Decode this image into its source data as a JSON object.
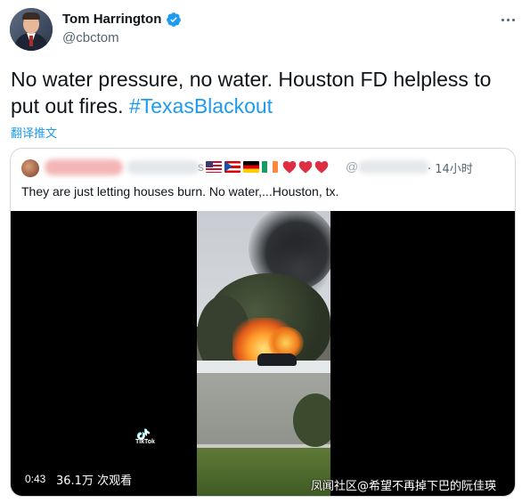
{
  "tweet": {
    "author_name": "Tom Harrington",
    "author_handle": "@cbctom",
    "verified": true,
    "text": "No water pressure, no water. Houston FD helpless to put out fires.",
    "hashtag": "#TexasBlackout",
    "translate_label": "翻译推文"
  },
  "quoted_tweet": {
    "name_suffix": "s",
    "flags": [
      "us-flag",
      "puerto-rico-flag",
      "germany-flag",
      "ireland-flag"
    ],
    "hearts": 3,
    "at_sign": "@",
    "time": "14小时",
    "text": "They are just letting houses burn. No water,...Houston,  tx.",
    "video": {
      "duration": "0:43",
      "views": "36.1万 次观看",
      "tiktok_label": "TikTok"
    }
  },
  "watermark": "凤闻社区@希望不再掉下巴的阮佳瑛",
  "colors": {
    "text": "#0f1419",
    "secondary": "#536471",
    "link": "#1d9bf0",
    "border": "#cfd9de"
  },
  "icons": [
    "verified-badge-icon",
    "more-icon",
    "tiktok-icon",
    "heart-icon"
  ]
}
